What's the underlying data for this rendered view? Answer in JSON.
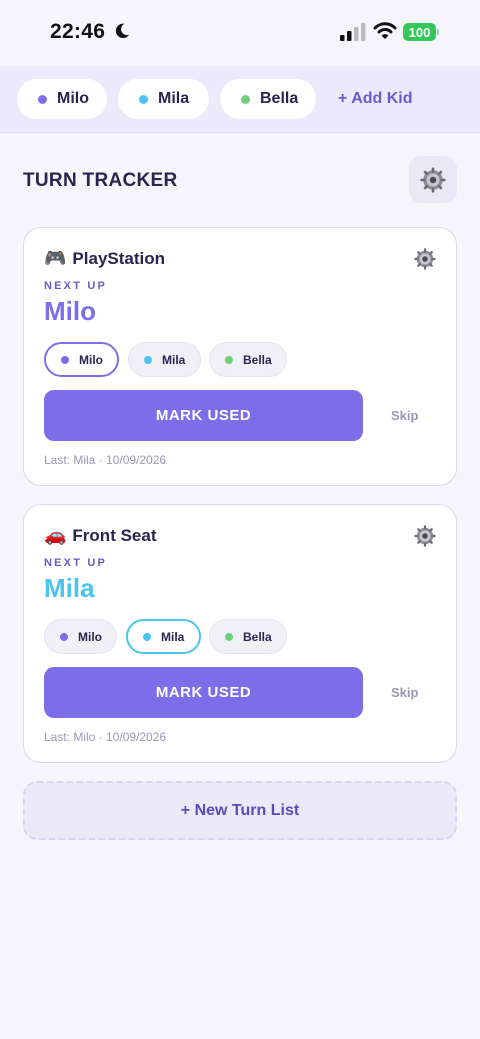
{
  "status_bar": {
    "time": "22:46",
    "battery": "100"
  },
  "kids": [
    {
      "name": "Milo",
      "color": "#7b6ee8"
    },
    {
      "name": "Mila",
      "color": "#4cc4ee"
    },
    {
      "name": "Bella",
      "color": "#6fcf7a"
    }
  ],
  "add_kid_label": "+ Add Kid",
  "section_title": "TURN TRACKER",
  "cards": [
    {
      "emoji": "🎮",
      "title": "PlayStation",
      "next_up_label": "NEXT UP",
      "next_up_name": "Milo",
      "next_up_color": "#7b6ee8",
      "order": [
        "Milo",
        "Mila",
        "Bella"
      ],
      "active": "Milo",
      "mark_used_label": "MARK USED",
      "skip_label": "Skip",
      "last": "Last: Mila · 10/09/2026"
    },
    {
      "emoji": "🚗",
      "title": "Front Seat",
      "next_up_label": "NEXT UP",
      "next_up_name": "Mila",
      "next_up_color": "#4cc4ee",
      "order": [
        "Milo",
        "Mila",
        "Bella"
      ],
      "active": "Mila",
      "mark_used_label": "MARK USED",
      "skip_label": "Skip",
      "last": "Last: Milo · 10/09/2026"
    }
  ],
  "new_list_label": "+ New Turn List"
}
